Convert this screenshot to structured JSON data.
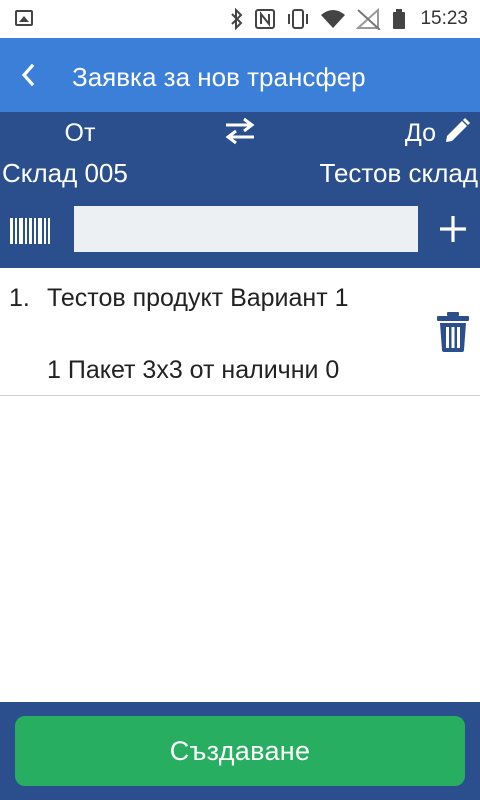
{
  "status_bar": {
    "time": "15:23",
    "icons": [
      "gallery-icon",
      "bluetooth-icon",
      "nfc-icon",
      "vibrate-icon",
      "wifi-icon",
      "no-signal-icon",
      "battery-icon"
    ]
  },
  "app_bar": {
    "back_icon": "chevron-left-icon",
    "title": "Заявка за нов трансфер"
  },
  "transfer": {
    "from_label": "От",
    "from_warehouse": "Склад 005",
    "to_label": "До",
    "to_warehouse": "Тестов склад",
    "swap_icon": "swap-arrows-icon",
    "edit_icon": "pencil-icon"
  },
  "search": {
    "value": "",
    "placeholder": "",
    "barcode_icon": "barcode-icon",
    "add_icon": "plus-icon"
  },
  "items": [
    {
      "index": "1.",
      "name": "Тестов продукт Вариант 1",
      "quantity_text": "1 Пакет 3x3 от налични 0",
      "delete_icon": "trash-icon"
    }
  ],
  "footer": {
    "create_label": "Създаване"
  },
  "colors": {
    "app_bar": "#3b7fd9",
    "panel": "#2a4f8c",
    "create_button": "#27ae60",
    "trash": "#2a4f8c"
  }
}
